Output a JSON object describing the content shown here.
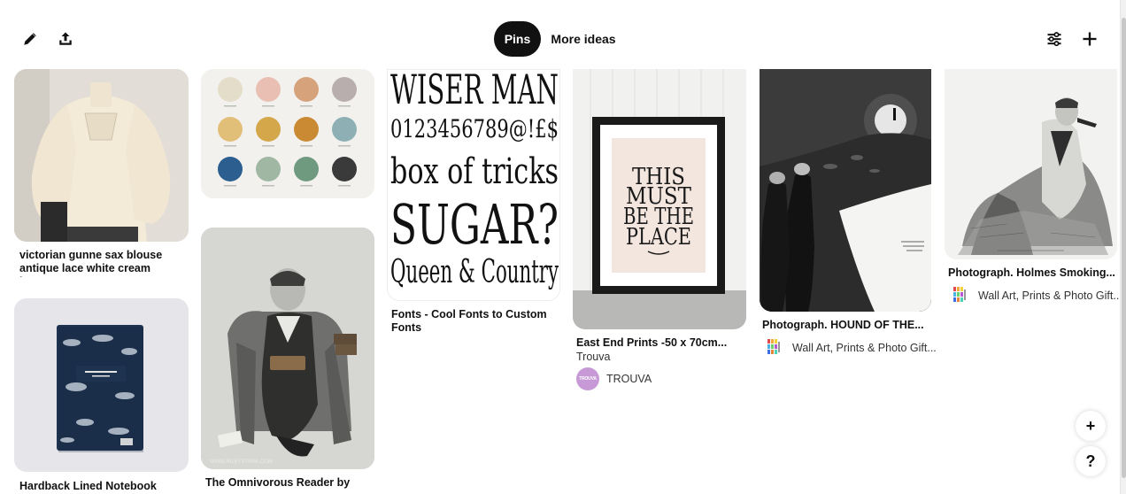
{
  "header": {
    "edit_icon": "pencil-icon",
    "share_icon": "share-upload-icon",
    "tabs": [
      {
        "label": "Pins",
        "active": true
      },
      {
        "label": "More ideas",
        "active": false
      }
    ],
    "filter_icon": "sliders-icon",
    "add_icon": "plus-icon"
  },
  "pins": [
    {
      "title": "victorian gunne sax blouse antique lace white cream ivory..."
    },
    {
      "title": "Hardback Lined Notebook The..."
    },
    {
      "color_swatches": [
        "#e3ddc9",
        "#e9bfb3",
        "#d6a27c",
        "#b9aeae",
        "#e2bf79",
        "#d4a74b",
        "#c98a33",
        "#8eb0b5",
        "#2c5f8f",
        "#9fb7a3",
        "#6f9a80",
        "#3a3a3a"
      ]
    },
    {
      "title": "The Omnivorous Reader by",
      "image_credit": "WWW.RILEYSTARK.COM"
    },
    {
      "title": "Fonts - Cool Fonts to Custom Fonts",
      "image_lines": [
        "WISER MAN",
        "0123456789@!£$",
        "box of tricks",
        "SUGAR?",
        "Queen & Country"
      ]
    },
    {
      "title": "East End Prints -50 x 70cm...",
      "subtitle": "Trouva",
      "creator": "TROUVA",
      "avatar_text": "TROUVA",
      "avatar_color": "#c79ad7",
      "image_lines": [
        "THIS",
        "MUST",
        "BE THE",
        "PLACE"
      ]
    },
    {
      "title": "Photograph. HOUND OF THE...",
      "creator": "Wall Art, Prints & Photo Gift..."
    },
    {
      "title": "Photograph. Holmes Smoking...",
      "creator": "Wall Art, Prints & Photo Gift..."
    }
  ],
  "floating": {
    "add_label": "+",
    "help_label": "?"
  }
}
